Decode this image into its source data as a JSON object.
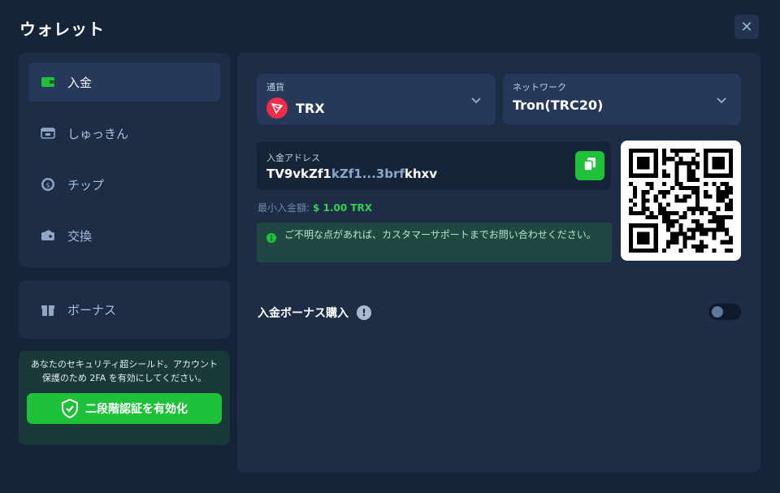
{
  "window": {
    "title": "ウォレット",
    "close_icon": "close-icon"
  },
  "nav": {
    "items": [
      {
        "label": "入金",
        "icon": "wallet-icon",
        "active": true
      },
      {
        "label": "しゅっきん",
        "icon": "withdraw-icon",
        "active": false
      },
      {
        "label": "チップ",
        "icon": "coin-icon",
        "active": false
      },
      {
        "label": "交換",
        "icon": "exchange-icon",
        "active": false
      }
    ],
    "bonus": {
      "label": "ボーナス",
      "icon": "gift-icon"
    }
  },
  "security": {
    "text": "あなたのセキュリティ超シールド。アカウント保護のため 2FA を有効にしてください。",
    "button_label": "二段階認証を有効化",
    "button_icon": "shield-check-icon"
  },
  "deposit": {
    "currency": {
      "label": "通貨",
      "value": "TRX",
      "icon": "trx-icon"
    },
    "network": {
      "label": "ネットワーク",
      "value": "Tron(TRC20)"
    },
    "address": {
      "label": "入金アドレス",
      "start": "TV9vkZf1",
      "middle": "kZf1...3brf",
      "end": "khxv"
    },
    "min": {
      "label": "最小入金額:",
      "amount": "$ 1.00 TRX"
    },
    "notice": "ご不明な点があれば、カスタマーサポートまでお問い合わせください。",
    "bonus_purchase": {
      "label": "入金ボーナス購入",
      "enabled": false
    }
  },
  "colors": {
    "background": "#16243a",
    "panel": "#1c2d45",
    "accent_green": "#1fc13a",
    "trx_red": "#ef2c4a"
  }
}
